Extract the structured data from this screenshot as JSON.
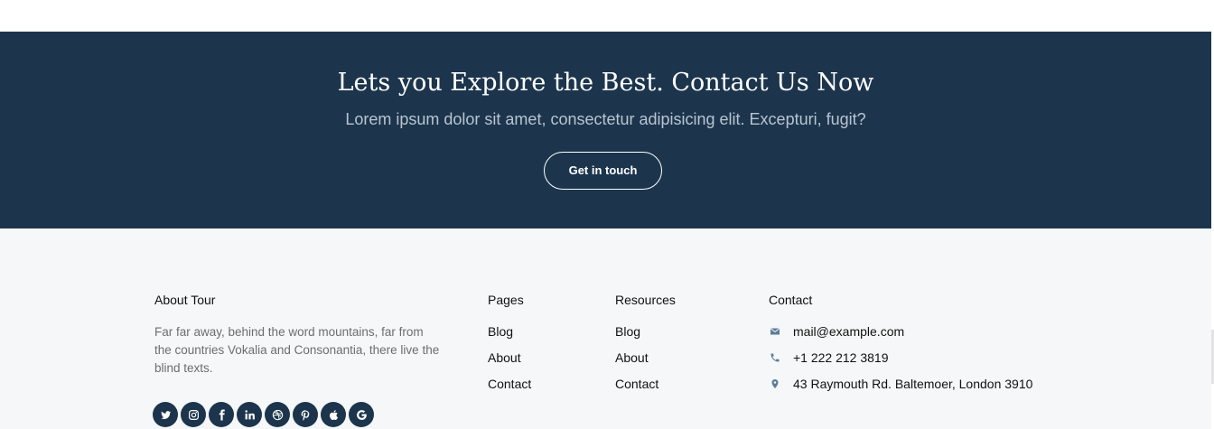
{
  "cta": {
    "heading": "Lets you Explore the Best. Contact Us Now",
    "subheading": "Lorem ipsum dolor sit amet, consectetur adipisicing elit. Excepturi, fugit?",
    "button_label": "Get in touch"
  },
  "footer": {
    "about": {
      "title": "About Tour",
      "text": "Far far away, behind the word mountains, far from the countries Vokalia and Consonantia, there live the blind texts."
    },
    "social_icons": [
      "twitter-icon",
      "instagram-icon",
      "facebook-icon",
      "linkedin-icon",
      "dribbble-icon",
      "pinterest-icon",
      "apple-icon",
      "google-icon"
    ],
    "pages": {
      "title": "Pages",
      "links": [
        "Blog",
        "About",
        "Contact"
      ]
    },
    "resources": {
      "title": "Resources",
      "links": [
        "Blog",
        "About",
        "Contact"
      ]
    },
    "contact": {
      "title": "Contact",
      "email": "mail@example.com",
      "phone": "+1 222 212 3819",
      "address": "43 Raymouth Rd. Baltemoer, London 3910"
    }
  },
  "colors": {
    "cta_background": "#1c354d",
    "footer_background": "#f6f7f8",
    "social_background": "#1c354d",
    "contact_icon": "#5b7c99"
  }
}
